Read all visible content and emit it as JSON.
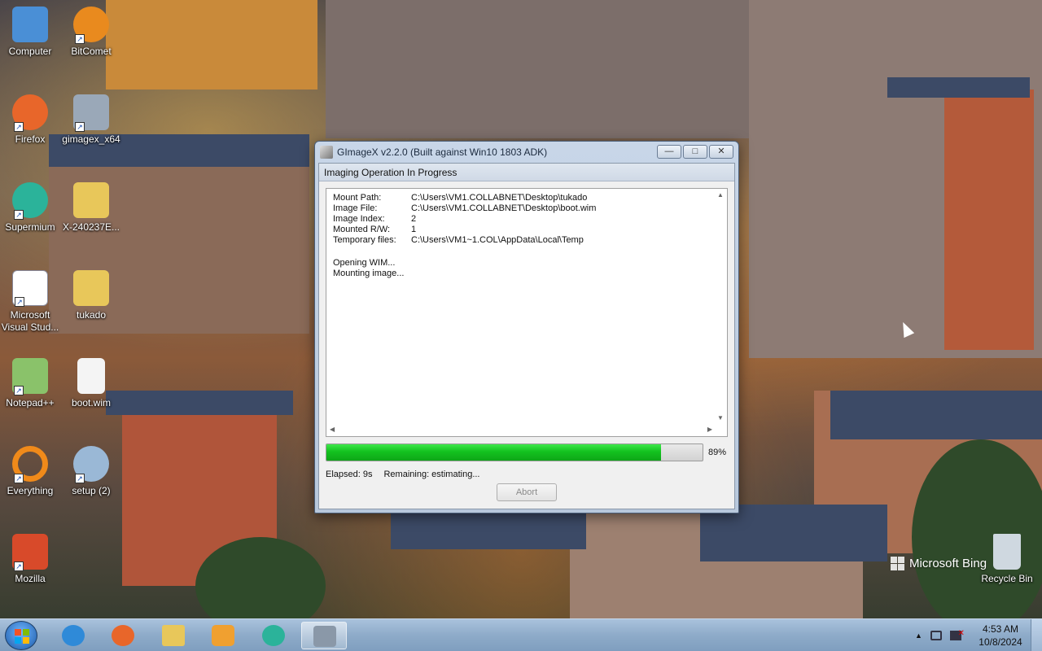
{
  "desktop": {
    "icons": [
      {
        "label": "Computer",
        "icon": "computer-icon",
        "color": "#4a8fd6"
      },
      {
        "label": "BitComet",
        "icon": "bitcomet-icon",
        "color": "#e98a1e"
      },
      {
        "label": "Firefox",
        "icon": "firefox-icon",
        "color": "#e8662a"
      },
      {
        "label": "gimagex_x64",
        "icon": "gimagex-icon",
        "color": "#9aa8b8"
      },
      {
        "label": "Supermium",
        "icon": "supermium-icon",
        "color": "#2bb39a"
      },
      {
        "label": "X-240237E...",
        "icon": "folder-icon",
        "color": "#e8c75a"
      },
      {
        "label": "Microsoft Visual Stud...",
        "icon": "visual-studio-icon",
        "color": "#ffffff"
      },
      {
        "label": "tukado",
        "icon": "folder-icon",
        "color": "#e8c75a"
      },
      {
        "label": "Notepad++",
        "icon": "notepadpp-icon",
        "color": "#8ac26a"
      },
      {
        "label": "boot.wim",
        "icon": "file-icon",
        "color": "#f4f4f4"
      },
      {
        "label": "Everything",
        "icon": "everything-icon",
        "color": "#f08a1a"
      },
      {
        "label": "setup (2)",
        "icon": "setup-icon",
        "color": "#9ab8d6"
      },
      {
        "label": "Mozilla",
        "icon": "mozilla-icon",
        "color": "#d84a2a"
      },
      {
        "label": "Recycle Bin",
        "icon": "recycle-bin-icon",
        "color": "#cfd8e0"
      }
    ],
    "watermark": "Microsoft Bing"
  },
  "window": {
    "title": "GImageX v2.2.0 (Built against Win10 1803 ADK)",
    "controls": {
      "minimize": "—",
      "maximize": "□",
      "close": "✕"
    },
    "subheader": "Imaging Operation In Progress",
    "log": {
      "rows": [
        {
          "key": "Mount Path:",
          "value": "C:\\Users\\VM1.COLLABNET\\Desktop\\tukado"
        },
        {
          "key": "Image File:",
          "value": "C:\\Users\\VM1.COLLABNET\\Desktop\\boot.wim"
        },
        {
          "key": "Image Index:",
          "value": "2"
        },
        {
          "key": "Mounted R/W:",
          "value": "1"
        },
        {
          "key": "Temporary files:",
          "value": "C:\\Users\\VM1~1.COL\\AppData\\Local\\Temp"
        }
      ],
      "messages": [
        "Opening WIM...",
        "Mounting image..."
      ]
    },
    "progress": {
      "value": 0.89,
      "label": "89%",
      "color": "#13c21f"
    },
    "elapsed": "Elapsed: 9s",
    "remaining": "Remaining: estimating...",
    "abort_label": "Abort"
  },
  "taskbar": {
    "items": [
      {
        "name": "internet-explorer",
        "icon": "ie-icon",
        "color": "#2f8ad8"
      },
      {
        "name": "firefox",
        "icon": "firefox-icon",
        "color": "#e8662a"
      },
      {
        "name": "file-explorer",
        "icon": "folder-icon",
        "color": "#e8c75a"
      },
      {
        "name": "media-player",
        "icon": "media-player-icon",
        "color": "#f0a030"
      },
      {
        "name": "supermium",
        "icon": "supermium-icon",
        "color": "#2bb39a"
      },
      {
        "name": "gimagex",
        "icon": "gimagex-icon",
        "color": "#8a98a8",
        "active": true
      }
    ],
    "tray": {
      "expand": "▲"
    },
    "clock": {
      "time": "4:53 AM",
      "date": "10/8/2024"
    }
  }
}
